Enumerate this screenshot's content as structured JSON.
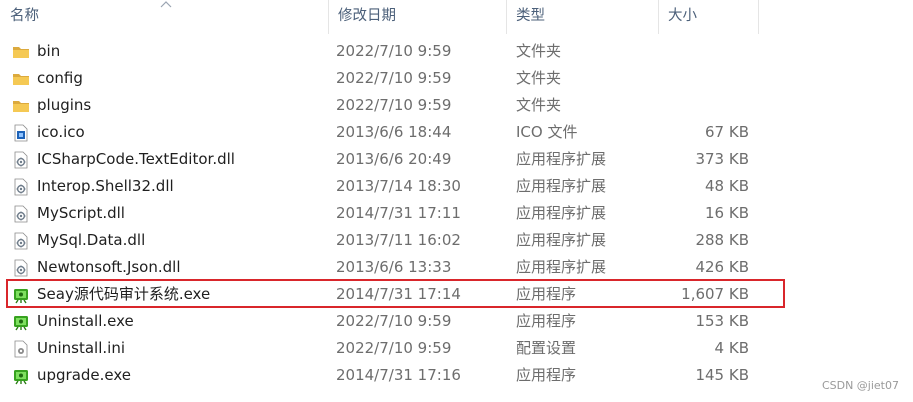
{
  "columns": {
    "name": "名称",
    "date": "修改日期",
    "type": "类型",
    "size": "大小"
  },
  "files": [
    {
      "name": "bin",
      "date": "2022/7/10 9:59",
      "type": "文件夹",
      "size": "",
      "icon": "folder-icon"
    },
    {
      "name": "config",
      "date": "2022/7/10 9:59",
      "type": "文件夹",
      "size": "",
      "icon": "folder-icon"
    },
    {
      "name": "plugins",
      "date": "2022/7/10 9:59",
      "type": "文件夹",
      "size": "",
      "icon": "folder-icon"
    },
    {
      "name": "ico.ico",
      "date": "2013/6/6 18:44",
      "type": "ICO 文件",
      "size": "67 KB",
      "icon": "ico-file-icon"
    },
    {
      "name": "ICSharpCode.TextEditor.dll",
      "date": "2013/6/6 20:49",
      "type": "应用程序扩展",
      "size": "373 KB",
      "icon": "dll-icon"
    },
    {
      "name": "Interop.Shell32.dll",
      "date": "2013/7/14 18:30",
      "type": "应用程序扩展",
      "size": "48 KB",
      "icon": "dll-icon"
    },
    {
      "name": "MyScript.dll",
      "date": "2014/7/31 17:11",
      "type": "应用程序扩展",
      "size": "16 KB",
      "icon": "dll-icon"
    },
    {
      "name": "MySql.Data.dll",
      "date": "2013/7/11 16:02",
      "type": "应用程序扩展",
      "size": "288 KB",
      "icon": "dll-icon"
    },
    {
      "name": "Newtonsoft.Json.dll",
      "date": "2013/6/6 13:33",
      "type": "应用程序扩展",
      "size": "426 KB",
      "icon": "dll-icon"
    },
    {
      "name": "Seay源代码审计系统.exe",
      "date": "2014/7/31 17:14",
      "type": "应用程序",
      "size": "1,607 KB",
      "icon": "app-exe-icon"
    },
    {
      "name": "Uninstall.exe",
      "date": "2022/7/10 9:59",
      "type": "应用程序",
      "size": "153 KB",
      "icon": "app-exe-icon"
    },
    {
      "name": "Uninstall.ini",
      "date": "2022/7/10 9:59",
      "type": "配置设置",
      "size": "4 KB",
      "icon": "ini-settings-icon"
    },
    {
      "name": "upgrade.exe",
      "date": "2014/7/31 17:16",
      "type": "应用程序",
      "size": "145 KB",
      "icon": "app-exe-icon"
    }
  ],
  "watermark": "CSDN @jiet07",
  "colors": {
    "highlight_border": "#d9262b",
    "header_text": "#4c607a",
    "folder": "#f2c14e"
  }
}
